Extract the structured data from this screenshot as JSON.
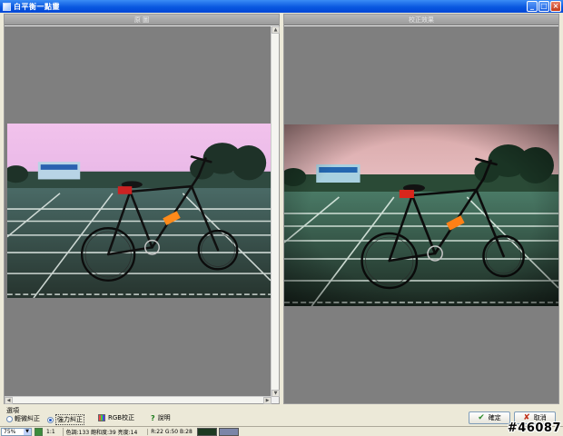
{
  "window": {
    "title": "白平衡一點靈",
    "controls": [
      "_",
      "□",
      "×"
    ]
  },
  "panels": {
    "original_label": "原 圖",
    "corrected_label": "校正效果"
  },
  "options": {
    "group_label": "選項",
    "radio_light": "輕微糾正",
    "radio_strong": "強力糾正",
    "rgb_button": "RGB校正",
    "help_button": "說明",
    "selected": "強力糾正"
  },
  "buttons": {
    "ok": "確定",
    "cancel": "取消"
  },
  "status": {
    "zoom": "75%",
    "ratio_button": "1:1",
    "color_info": "色調:133 飽和度:39 亮度:14",
    "rgb_info": "R:22 G:50 B:28",
    "swatch_dark": "#1d3a22",
    "swatch_light": "#7c86a8"
  },
  "watermark": "#46087",
  "colors": {
    "titlebar": "#0a58e0",
    "viewport": "#7f7f7f"
  }
}
